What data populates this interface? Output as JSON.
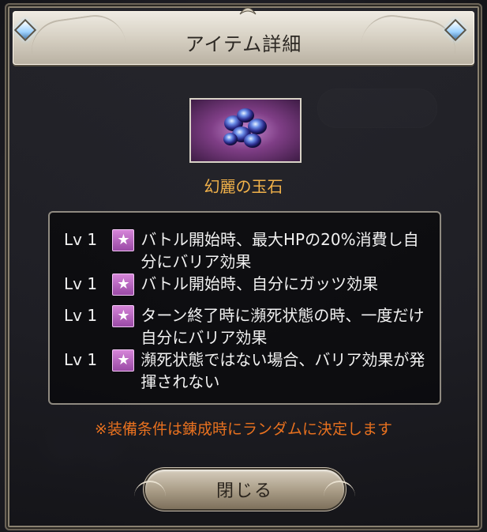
{
  "dialog": {
    "title": "アイテム詳細",
    "item_name": "幻麗の玉石",
    "effects": [
      {
        "level": "Lv 1",
        "icon": "star-icon",
        "text": "バトル開始時、最大HPの20%消費し自分にバリア効果"
      },
      {
        "level": "Lv 1",
        "icon": "star-icon",
        "text": "バトル開始時、自分にガッツ効果"
      },
      {
        "level": "Lv 1",
        "icon": "star-icon",
        "text": "ターン終了時に瀕死状態の時、一度だけ自分にバリア効果"
      },
      {
        "level": "Lv 1",
        "icon": "star-icon",
        "text": "瀕死状態ではない場合、バリア効果が発揮されない"
      }
    ],
    "note": "※装備条件は錬成時にランダムに決定します",
    "close_label": "閉じる"
  },
  "colors": {
    "item_name": "#f2b24a",
    "note": "#e8711f",
    "star_badge": "#c06ec8"
  }
}
